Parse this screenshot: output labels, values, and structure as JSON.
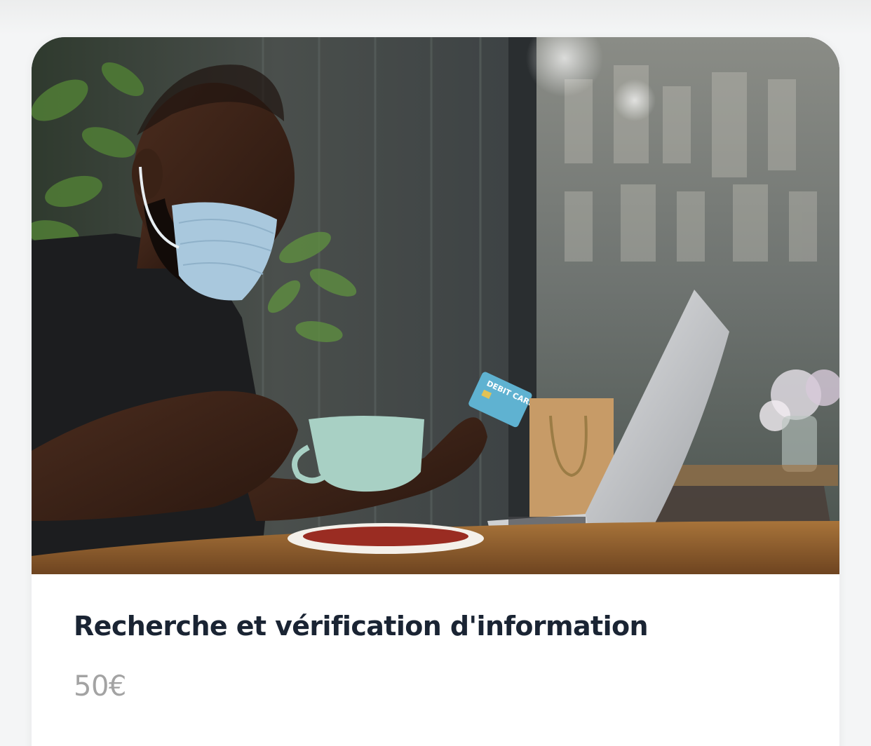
{
  "card": {
    "image_alt": "Man wearing a face mask holding a debit card and a cup at a laptop in a café",
    "card_text": "DEBIT CARD",
    "title": "Recherche et vérification d'information",
    "price": "50€"
  }
}
